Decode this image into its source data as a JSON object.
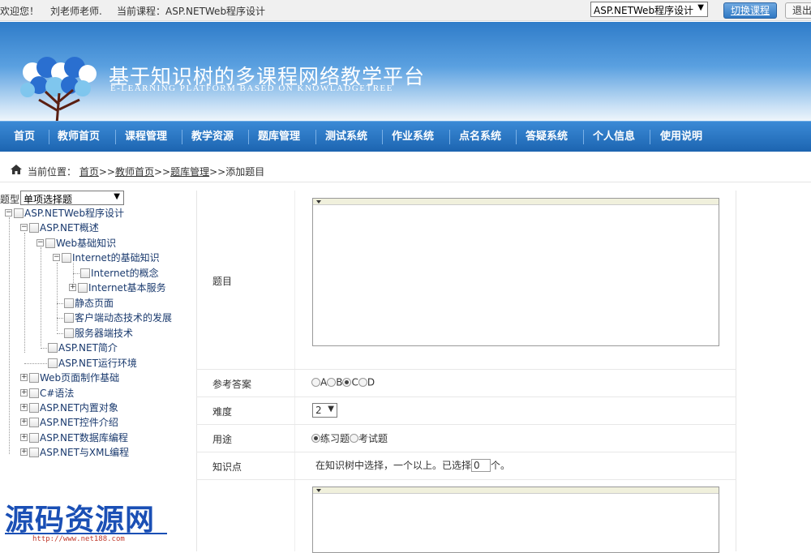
{
  "topbar": {
    "welcome": "欢迎您！",
    "user": "刘老师老师.",
    "current_course": "当前课程：ASP.NETWeb程序设计",
    "course_select_value": "ASP.NETWeb程序设计",
    "switch_label": "切换课程",
    "exit_label": "退出"
  },
  "banner": {
    "title": "基于知识树的多课程网络教学平台",
    "subtitle": "E-LEARNING PLATFORM BASED ON KNOWLADGETREE"
  },
  "nav": {
    "items": [
      "首页",
      "教师首页",
      "课程管理",
      "教学资源",
      "题库管理",
      "测试系统",
      "作业系统",
      "点名系统",
      "答疑系统",
      "个人信息",
      "使用说明"
    ]
  },
  "breadcrumb": {
    "prefix": "当前位置：",
    "links": [
      "首页",
      "教师首页",
      "题库管理"
    ],
    "sep": ">>",
    "current": "添加题目"
  },
  "left": {
    "type_label": "题型",
    "type_value": "单项选择题",
    "tree": [
      {
        "label": "ASP.NETWeb程序设计",
        "exp": "−"
      },
      {
        "label": "ASP.NET概述",
        "exp": "−"
      },
      {
        "label": "Web基础知识",
        "exp": "−"
      },
      {
        "label": "Internet的基础知识",
        "exp": "−"
      },
      {
        "label": "Internet的概念",
        "exp": ""
      },
      {
        "label": "Internet基本服务",
        "exp": "+"
      },
      {
        "label": "静态页面",
        "exp": ""
      },
      {
        "label": "客户端动态技术的发展",
        "exp": ""
      },
      {
        "label": "服务器端技术",
        "exp": ""
      },
      {
        "label": "ASP.NET简介",
        "exp": ""
      },
      {
        "label": "ASP.NET运行环境",
        "exp": ""
      },
      {
        "label": "Web页面制作基础",
        "exp": "+"
      },
      {
        "label": "C#语法",
        "exp": "+"
      },
      {
        "label": "ASP.NET内置对象",
        "exp": "+"
      },
      {
        "label": "ASP.NET控件介绍",
        "exp": "+"
      },
      {
        "label": "ASP.NET数据库编程",
        "exp": "+"
      },
      {
        "label": "ASP.NET与XML编程",
        "exp": "+"
      }
    ]
  },
  "form": {
    "question_label": "题目",
    "answer_label": "参考答案",
    "answer_options": [
      "A",
      "B",
      "C",
      "D"
    ],
    "answer_selected": "C",
    "difficulty_label": "难度",
    "difficulty_value": "2",
    "usage_label": "用途",
    "usage_options": [
      "练习题",
      "考试题"
    ],
    "usage_selected": "练习题",
    "knowledge_label": "知识点",
    "knowledge_hint_before": "在知识树中选择，一个以上。已选择",
    "knowledge_count": "0",
    "knowledge_hint_after": "个。"
  },
  "watermark": {
    "text": "源码资源网",
    "url": "http://www.net188.com"
  },
  "colors": {
    "nav_blue": "#1c64b0",
    "banner_blue": "#2f7cc9",
    "tree_text": "#1a3a6e",
    "watermark_blue": "#1a4fb5"
  }
}
